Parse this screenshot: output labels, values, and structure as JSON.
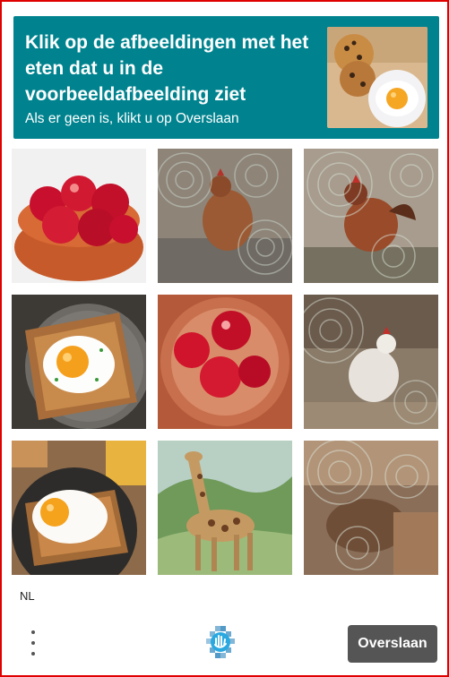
{
  "challenge": {
    "prompt": "Klik op de afbeeldingen met het eten dat u in de voorbeeldafbeelding ziet",
    "subprompt": "Als er geen is, klikt u op Overslaan",
    "sample_image": "cookies-and-fried-egg-image"
  },
  "grid": [
    {
      "image": "apples-in-basket-image"
    },
    {
      "image": "noisy-chicken-image"
    },
    {
      "image": "noisy-rooster-image"
    },
    {
      "image": "egg-on-toast-image"
    },
    {
      "image": "apples-in-bowl-image"
    },
    {
      "image": "noisy-white-chicken-image"
    },
    {
      "image": "egg-breakfast-plate-image"
    },
    {
      "image": "giraffe-image"
    },
    {
      "image": "noisy-blurred-image"
    }
  ],
  "footer": {
    "language": "NL",
    "skip_label": "Overslaan",
    "menu_icon": "vertical-dots-icon",
    "logo_icon": "hcaptcha-hand-icon"
  },
  "colors": {
    "header_bg": "#00838f",
    "skip_bg": "#555555",
    "frame_border": "#e00000"
  }
}
